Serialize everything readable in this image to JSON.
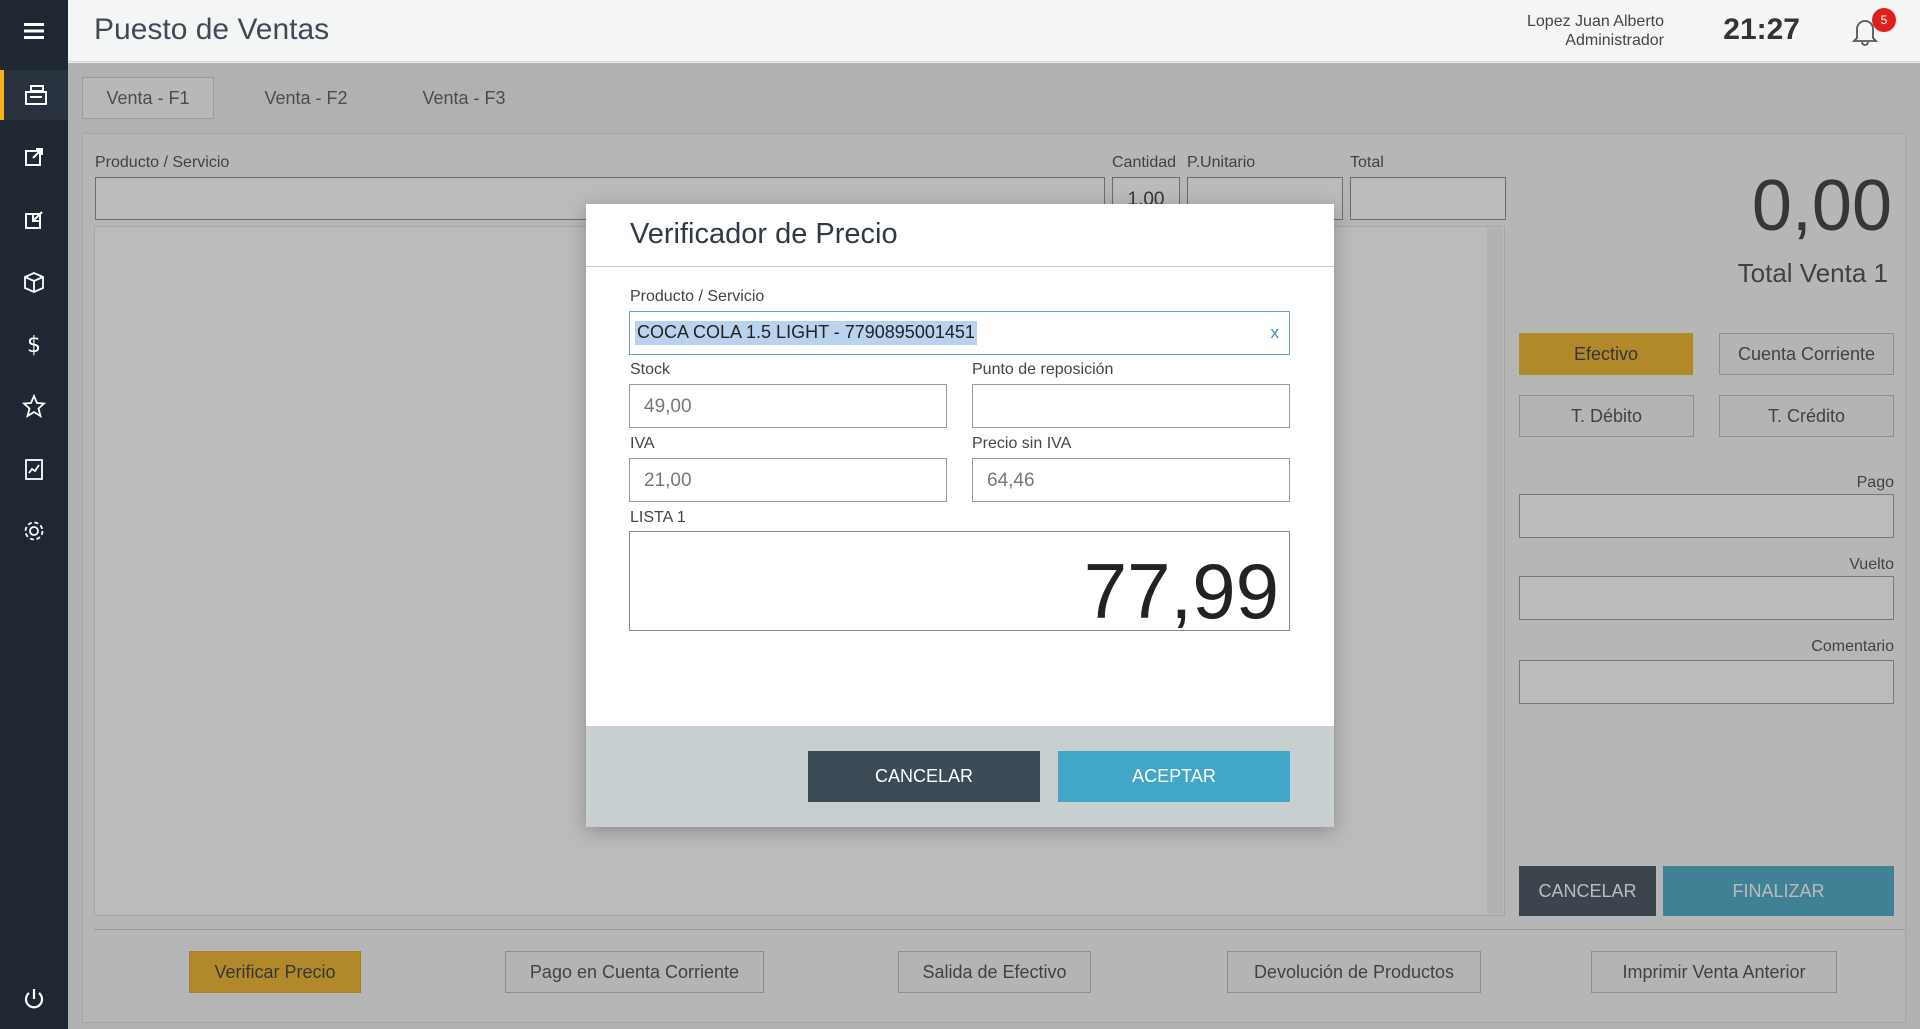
{
  "app": {
    "title": "Puesto de Ventas"
  },
  "user": {
    "name": "Lopez Juan Alberto",
    "role": "Administrador"
  },
  "clock": "21:27",
  "notifications": {
    "count": "5"
  },
  "sidebar": {
    "items": [
      {
        "icon": "cash-register-icon",
        "active": true
      },
      {
        "icon": "export-icon"
      },
      {
        "icon": "import-icon"
      },
      {
        "icon": "box-icon"
      },
      {
        "icon": "dollar-icon"
      },
      {
        "icon": "star-icon"
      },
      {
        "icon": "report-icon"
      },
      {
        "icon": "gear-icon"
      }
    ],
    "power_icon": "power-icon"
  },
  "tabs": [
    {
      "label": "Venta - F1"
    },
    {
      "label": "Venta - F2"
    },
    {
      "label": "Venta - F3"
    }
  ],
  "sale": {
    "product_label": "Producto / Servicio",
    "quantity_label": "Cantidad",
    "quantity_value": "1,00",
    "unit_price_label": "P.Unitario",
    "total_label": "Total",
    "total_amount": "0,00",
    "total_caption": "Total Venta 1"
  },
  "payment": {
    "methods": [
      {
        "label": "Efectivo",
        "selected": true
      },
      {
        "label": "Cuenta Corriente"
      },
      {
        "label": "T. Débito"
      },
      {
        "label": "T. Crédito"
      }
    ],
    "pago_label": "Pago",
    "vuelto_label": "Vuelto",
    "comentario_label": "Comentario",
    "cancel_label": "CANCELAR",
    "finish_label": "FINALIZAR"
  },
  "footer_buttons": [
    {
      "label": "Verificar Precio",
      "selected": true
    },
    {
      "label": "Pago en Cuenta Corriente"
    },
    {
      "label": "Salida de Efectivo"
    },
    {
      "label": "Devolución de Productos"
    },
    {
      "label": "Imprimir Venta Anterior"
    }
  ],
  "modal": {
    "title": "Verificador de Precio",
    "product_label": "Producto / Servicio",
    "product_value": "COCA COLA 1.5 LIGHT - 7790895001451",
    "clear_label": "x",
    "stock_label": "Stock",
    "stock_value": "49,00",
    "reorder_label": "Punto de reposición",
    "reorder_value": "",
    "iva_label": "IVA",
    "iva_value": "21,00",
    "price_no_iva_label": "Precio sin IVA",
    "price_no_iva_value": "64,46",
    "list_label": "LISTA 1",
    "list_price": "77,99",
    "cancel_label": "CANCELAR",
    "accept_label": "ACEPTAR"
  },
  "colors": {
    "sidebar": "#1f2733",
    "accent_yellow": "#f0b323",
    "accent_blue": "#42a6c7",
    "dark_button": "#3c4a56"
  }
}
